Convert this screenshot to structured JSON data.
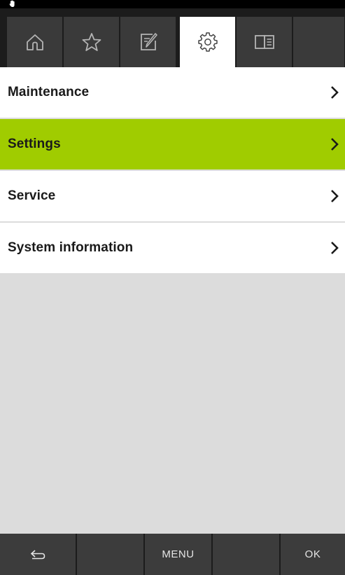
{
  "status_bar": {
    "icon": "hand-icon"
  },
  "top_tabs": [
    {
      "icon": "home-icon",
      "active": false
    },
    {
      "icon": "star-icon",
      "active": false
    },
    {
      "icon": "edit-icon",
      "active": false
    },
    {
      "icon": "gear-icon",
      "active": true
    },
    {
      "icon": "book-icon",
      "active": false
    }
  ],
  "menu": {
    "items": [
      {
        "label": "Maintenance",
        "selected": false
      },
      {
        "label": "Settings",
        "selected": true
      },
      {
        "label": "Service",
        "selected": false
      },
      {
        "label": "System information",
        "selected": false
      }
    ]
  },
  "bottom_bar": {
    "back_icon": "back-arrow-icon",
    "menu_label": "MENU",
    "ok_label": "OK"
  },
  "colors": {
    "accent": "#a0cc00",
    "background": "#dcdcdc",
    "bar": "#3c3c3c"
  }
}
